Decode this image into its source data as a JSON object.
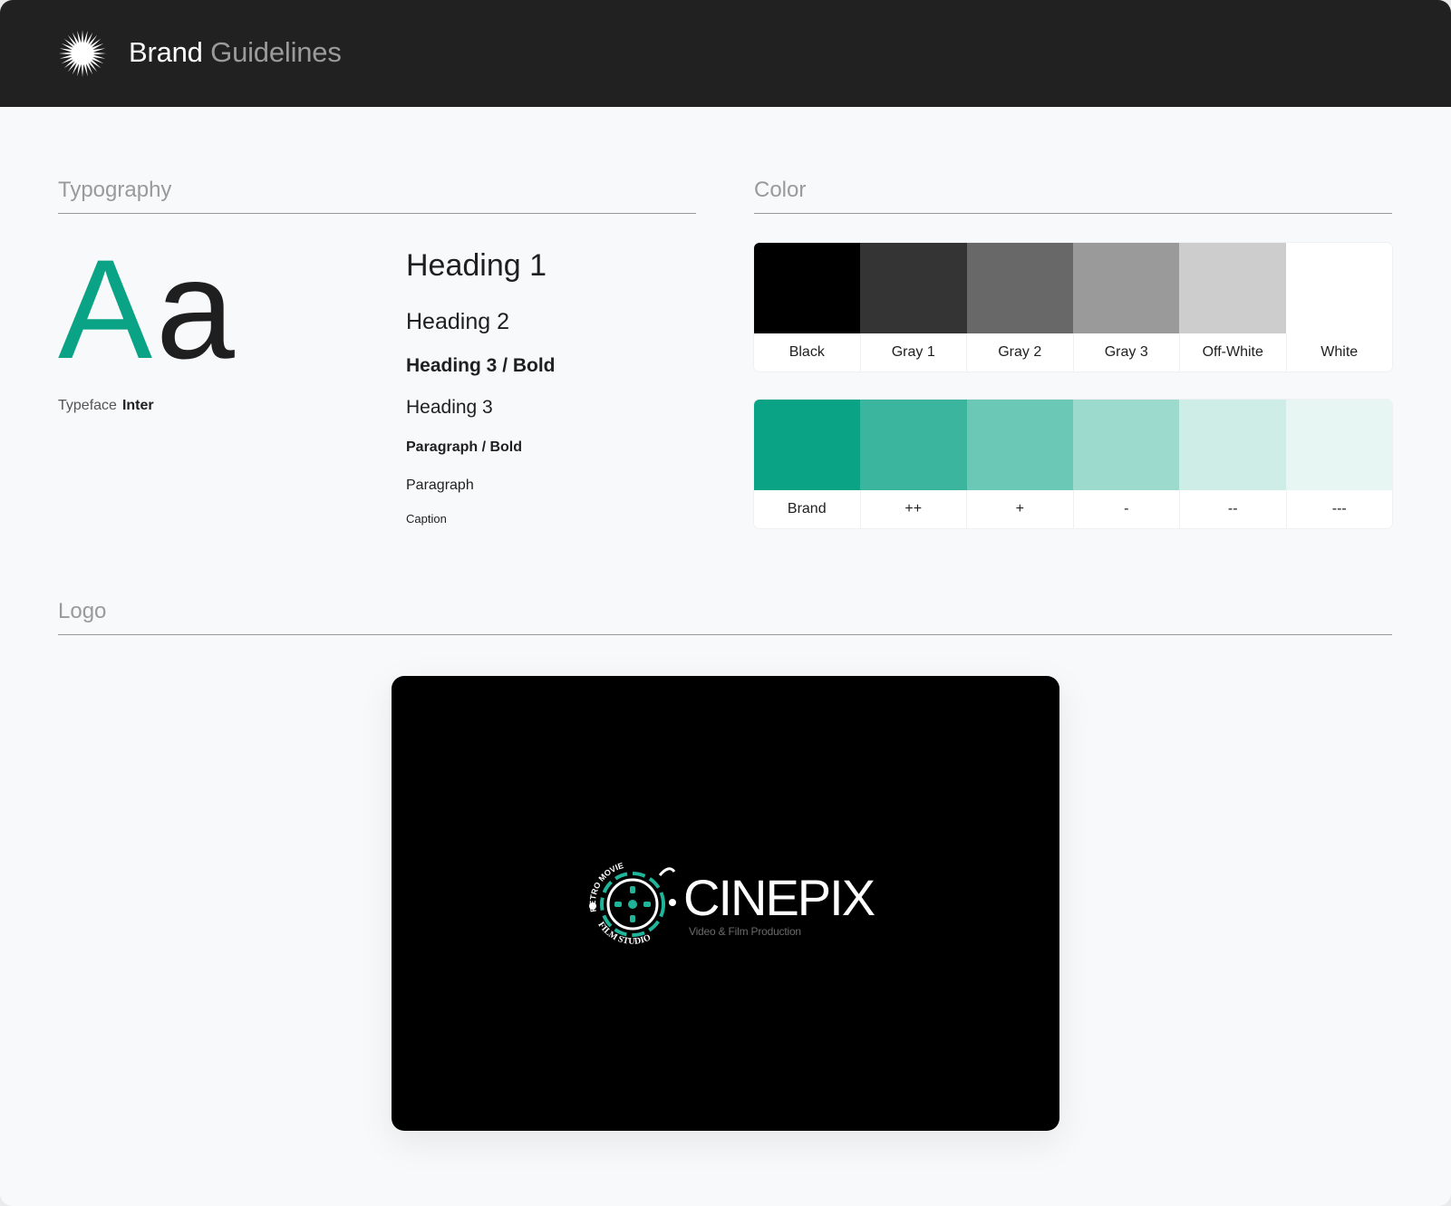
{
  "header": {
    "title_primary": "Brand",
    "title_secondary": "Guidelines",
    "logo_icon": "starburst-icon"
  },
  "typography": {
    "section_title": "Typography",
    "specimen_upper": "A",
    "specimen_lower": "a",
    "typeface_label": "Typeface",
    "typeface_value": "Inter",
    "samples": [
      {
        "label": "Heading 1"
      },
      {
        "label": "Heading 2"
      },
      {
        "label": "Heading 3 / Bold"
      },
      {
        "label": "Heading 3"
      },
      {
        "label": "Paragraph / Bold"
      },
      {
        "label": "Paragraph"
      },
      {
        "label": "Caption"
      }
    ]
  },
  "color": {
    "section_title": "Color",
    "neutrals": [
      {
        "name": "Black",
        "hex": "#000000"
      },
      {
        "name": "Gray 1",
        "hex": "#343434"
      },
      {
        "name": "Gray 2",
        "hex": "#686868"
      },
      {
        "name": "Gray 3",
        "hex": "#9a9a9a"
      },
      {
        "name": "Off-White",
        "hex": "#cdcdcd"
      },
      {
        "name": "White",
        "hex": "#ffffff"
      }
    ],
    "brand": [
      {
        "name": "Brand",
        "hex": "#0aa385"
      },
      {
        "name": "++",
        "hex": "#3bb59d"
      },
      {
        "name": "+",
        "hex": "#6cc8b6"
      },
      {
        "name": "-",
        "hex": "#9ddace"
      },
      {
        "name": "--",
        "hex": "#ceede7"
      },
      {
        "name": "---",
        "hex": "#e7f6f3"
      }
    ]
  },
  "logo": {
    "section_title": "Logo",
    "wordmark": "CINEPIX",
    "tagline": "Video & Film Production",
    "emblem_top_text": "RETRO MOVIE",
    "emblem_bottom_text": "FILM STUDIO",
    "emblem_icon": "film-reel-icon",
    "accent": "#1fb59b"
  }
}
